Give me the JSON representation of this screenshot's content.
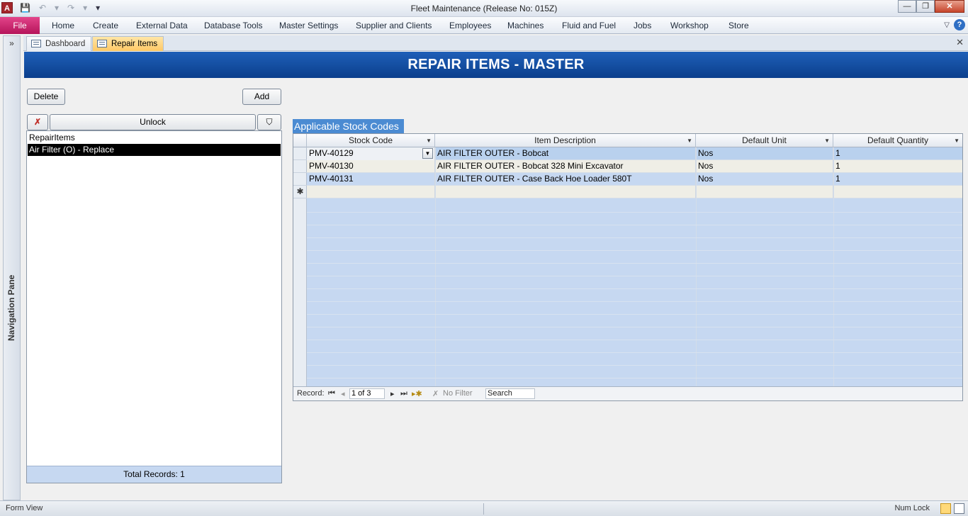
{
  "window": {
    "title": "Fleet Maintenance (Release No: 015Z)",
    "app_icon_letter": "A",
    "qat": [
      "💾",
      "↶",
      "▾",
      "↷",
      "▾",
      "▾"
    ],
    "buttons": [
      "—",
      "❐",
      "✕"
    ]
  },
  "ribbon": {
    "file_label": "File",
    "tabs": [
      "Home",
      "Create",
      "External Data",
      "Database Tools",
      "Master Settings",
      "Supplier and Clients",
      "Employees",
      "Machines",
      "Fluid and Fuel",
      "Jobs",
      "Workshop",
      "Store"
    ],
    "collapse_glyph": "▽",
    "help_glyph": "?"
  },
  "nav_pane": {
    "label": "Navigation Pane",
    "expand_glyph": "»"
  },
  "doc_tabs": [
    {
      "label": "Dashboard",
      "active": false
    },
    {
      "label": "Repair Items",
      "active": true
    }
  ],
  "doc_close_glyph": "✕",
  "form": {
    "title": "REPAIR ITEMS - MASTER",
    "delete_label": "Delete",
    "add_label": "Add",
    "clear_filter_glyph": "✗",
    "unlock_label": "Unlock",
    "filter_glyph": "⛉",
    "list_header": "RepairItems",
    "list_items": [
      "Air Filter (O) - Replace"
    ],
    "total_records": "Total Records: 1"
  },
  "subform": {
    "caption": "Applicable Stock Codes",
    "columns": [
      "Stock Code",
      "Item Description",
      "Default Unit",
      "Default Quantity"
    ],
    "rows": [
      [
        "PMV-40129",
        "AIR FILTER OUTER - Bobcat",
        "Nos",
        "1"
      ],
      [
        "PMV-40130",
        "AIR FILTER OUTER - Bobcat 328 Mini Excavator",
        "Nos",
        "1"
      ],
      [
        "PMV-40131",
        "AIR FILTER OUTER - Case Back Hoe Loader 580T",
        "Nos",
        "1"
      ]
    ],
    "new_row_glyph": "✱",
    "navigator": {
      "record_label": "Record:",
      "current": "1 of 3",
      "no_filter": "No Filter",
      "search_placeholder": "Search",
      "first": "⏮",
      "prev": "◂",
      "next": "▸",
      "last": "⏭",
      "new": "▸✱"
    }
  },
  "status": {
    "left": "Form View",
    "right": "Num Lock"
  },
  "colors": {
    "header_blue": "#1f5fb8",
    "selection_black": "#000000",
    "grid_blue": "#c6d8f1",
    "active_tab": "#ffc865"
  }
}
